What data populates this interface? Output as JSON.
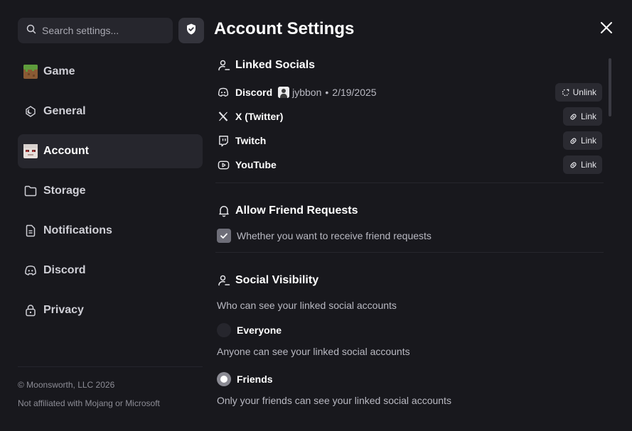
{
  "search": {
    "placeholder": "Search settings..."
  },
  "sidebar": {
    "items": [
      {
        "label": "Game",
        "icon": "grass-block-icon"
      },
      {
        "label": "General",
        "icon": "moon-icon"
      },
      {
        "label": "Account",
        "icon": "user-avatar-icon",
        "active": true
      },
      {
        "label": "Storage",
        "icon": "folder-icon"
      },
      {
        "label": "Notifications",
        "icon": "document-icon"
      },
      {
        "label": "Discord",
        "icon": "discord-icon"
      },
      {
        "label": "Privacy",
        "icon": "lock-icon"
      }
    ],
    "footer": {
      "copyright": "© Moonsworth, LLC 2026",
      "disclaimer": "Not affiliated with Mojang or Microsoft"
    }
  },
  "main": {
    "title": "Account Settings",
    "linked_socials": {
      "title": "Linked Socials",
      "rows": [
        {
          "name": "Discord",
          "username": "jybbon",
          "date": "2/19/2025",
          "separator": "•",
          "action": "Unlink",
          "icon": "discord-icon"
        },
        {
          "name": "X (Twitter)",
          "action": "Link",
          "icon": "x-icon"
        },
        {
          "name": "Twitch",
          "action": "Link",
          "icon": "twitch-icon"
        },
        {
          "name": "YouTube",
          "action": "Link",
          "icon": "youtube-icon"
        }
      ]
    },
    "friend_requests": {
      "title": "Allow Friend Requests",
      "checkbox_label": "Whether you want to receive friend requests",
      "checked": true
    },
    "social_visibility": {
      "title": "Social Visibility",
      "description": "Who can see your linked social accounts",
      "options": [
        {
          "label": "Everyone",
          "description": "Anyone can see your linked social accounts",
          "selected": false
        },
        {
          "label": "Friends",
          "description": "Only your friends can see your linked social accounts",
          "selected": true
        }
      ]
    }
  }
}
